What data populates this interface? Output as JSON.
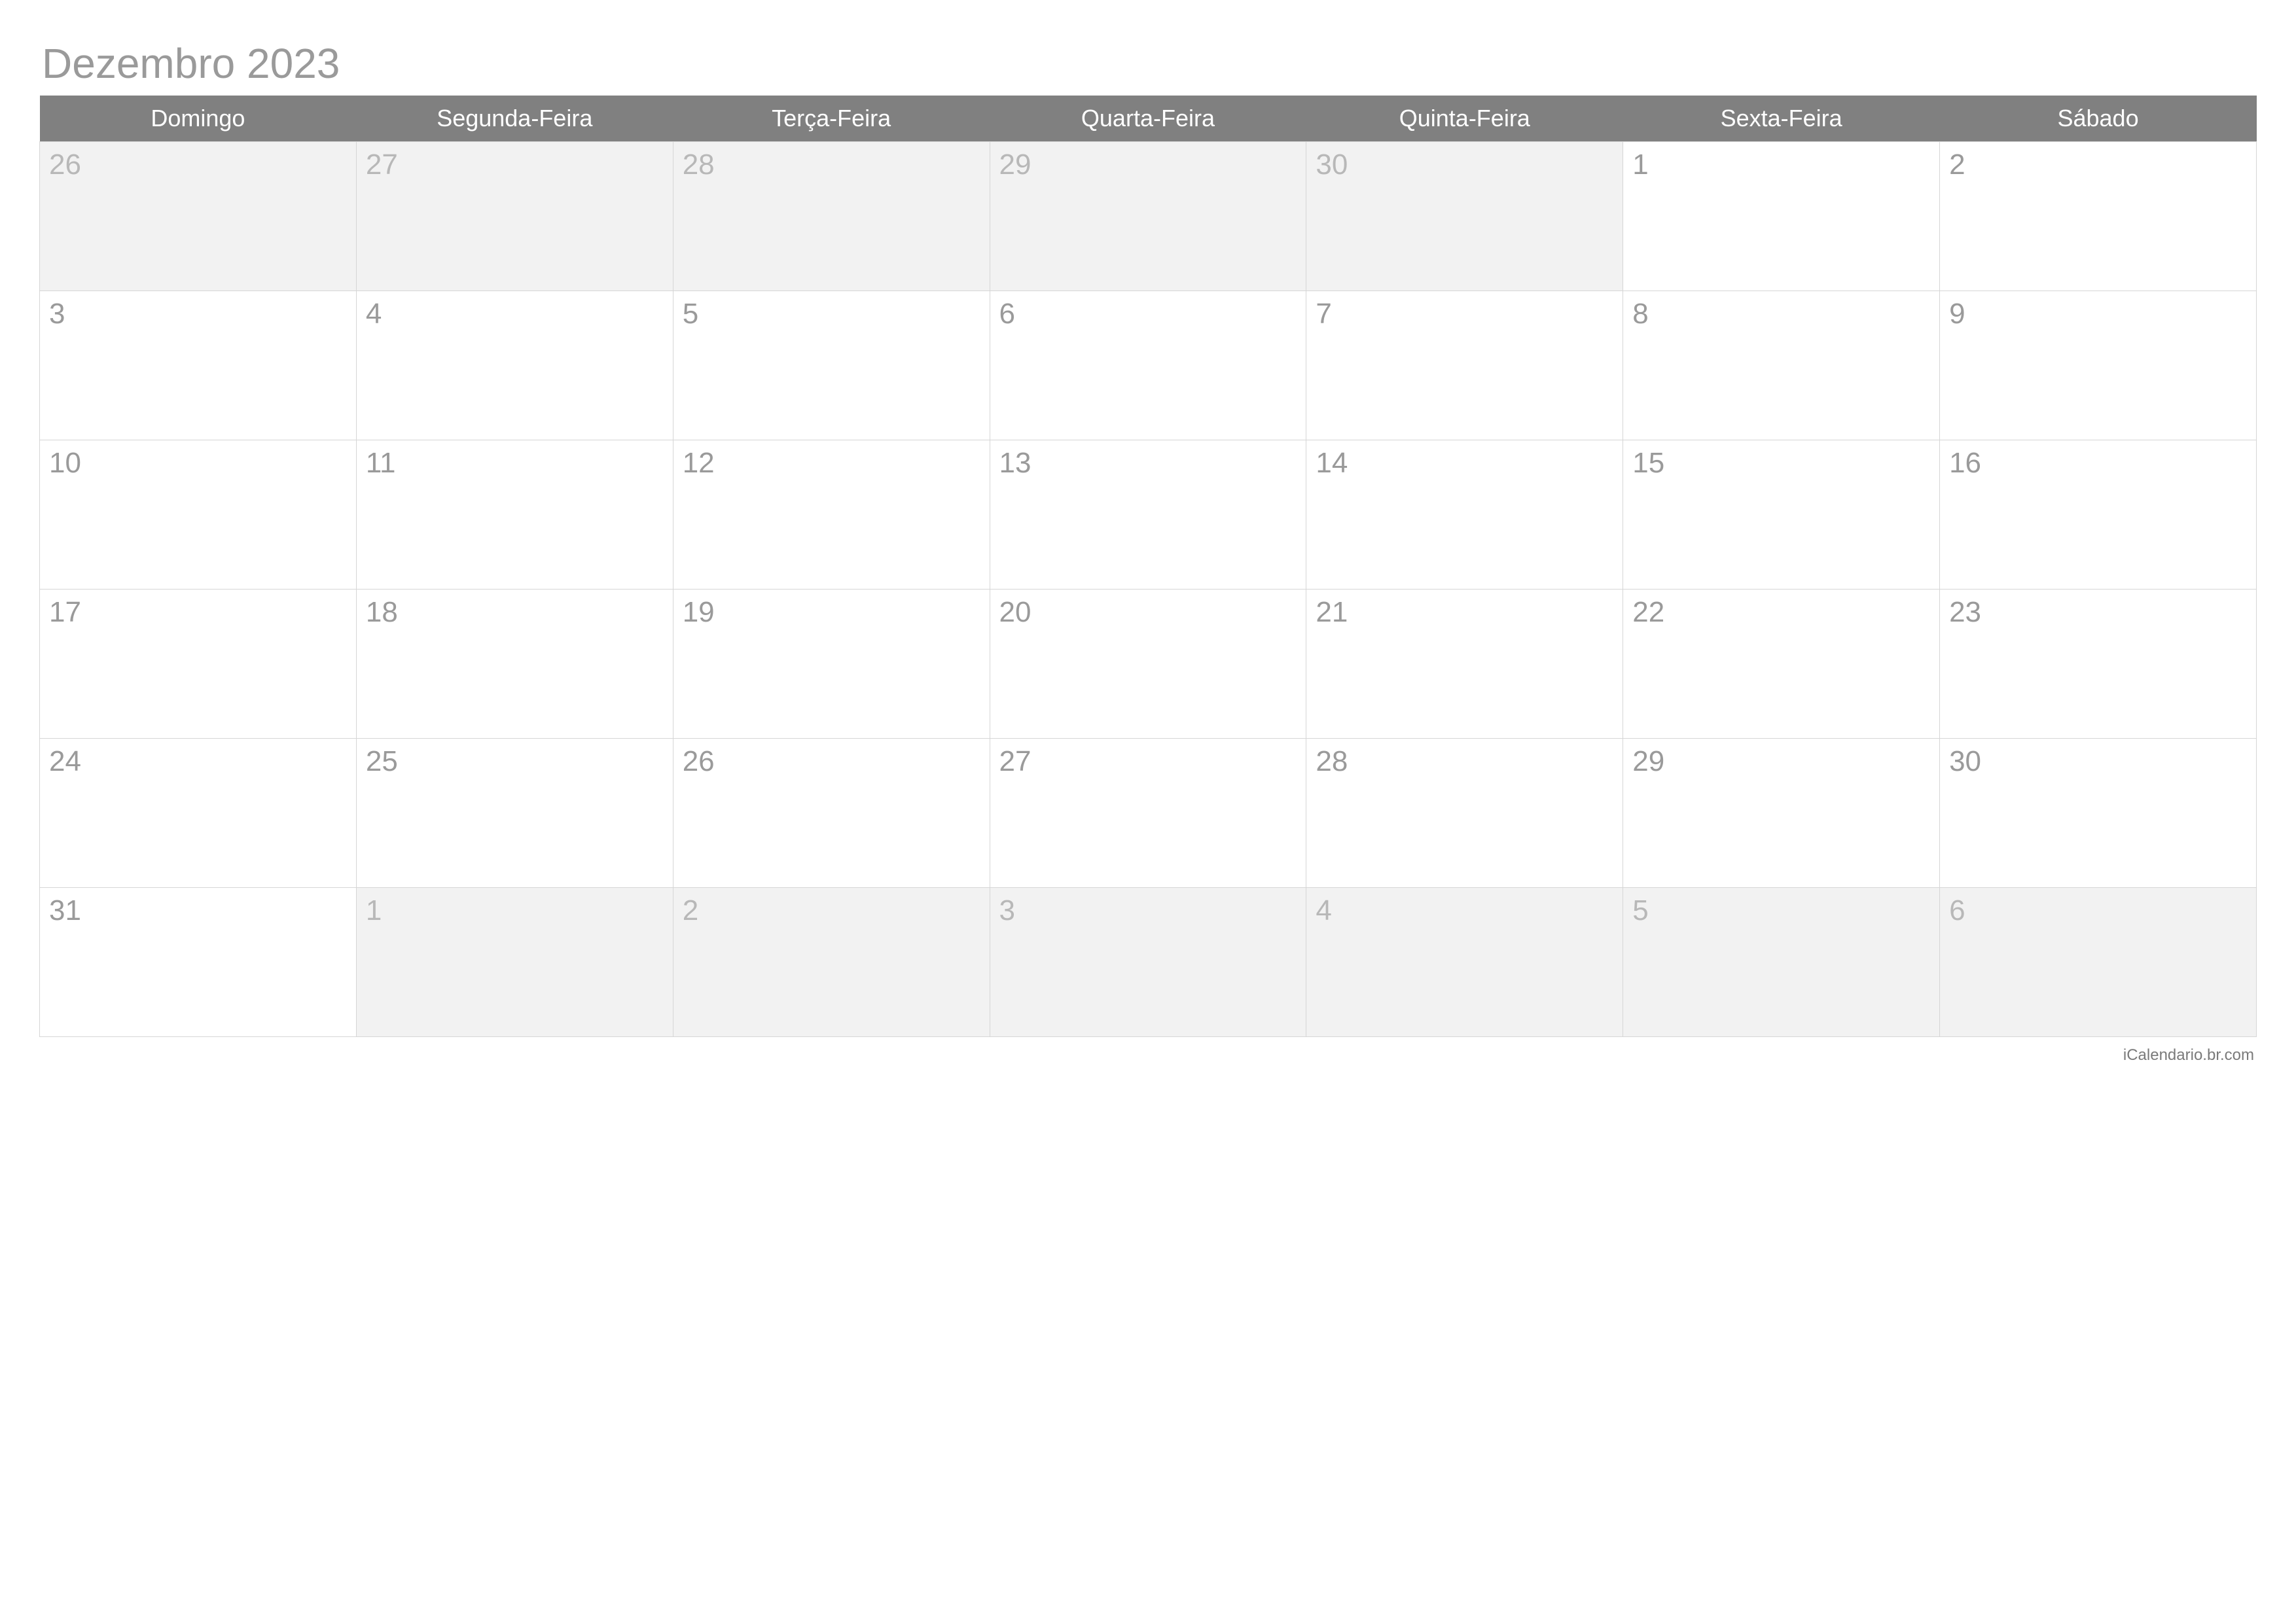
{
  "title": "Dezembro 2023",
  "weekdays": [
    "Domingo",
    "Segunda-Feira",
    "Terça-Feira",
    "Quarta-Feira",
    "Quinta-Feira",
    "Sexta-Feira",
    "Sábado"
  ],
  "weeks": [
    [
      {
        "day": "26",
        "other_month": true
      },
      {
        "day": "27",
        "other_month": true
      },
      {
        "day": "28",
        "other_month": true
      },
      {
        "day": "29",
        "other_month": true
      },
      {
        "day": "30",
        "other_month": true
      },
      {
        "day": "1",
        "other_month": false
      },
      {
        "day": "2",
        "other_month": false
      }
    ],
    [
      {
        "day": "3",
        "other_month": false
      },
      {
        "day": "4",
        "other_month": false
      },
      {
        "day": "5",
        "other_month": false
      },
      {
        "day": "6",
        "other_month": false
      },
      {
        "day": "7",
        "other_month": false
      },
      {
        "day": "8",
        "other_month": false
      },
      {
        "day": "9",
        "other_month": false
      }
    ],
    [
      {
        "day": "10",
        "other_month": false
      },
      {
        "day": "11",
        "other_month": false
      },
      {
        "day": "12",
        "other_month": false
      },
      {
        "day": "13",
        "other_month": false
      },
      {
        "day": "14",
        "other_month": false
      },
      {
        "day": "15",
        "other_month": false
      },
      {
        "day": "16",
        "other_month": false
      }
    ],
    [
      {
        "day": "17",
        "other_month": false
      },
      {
        "day": "18",
        "other_month": false
      },
      {
        "day": "19",
        "other_month": false
      },
      {
        "day": "20",
        "other_month": false
      },
      {
        "day": "21",
        "other_month": false
      },
      {
        "day": "22",
        "other_month": false
      },
      {
        "day": "23",
        "other_month": false
      }
    ],
    [
      {
        "day": "24",
        "other_month": false
      },
      {
        "day": "25",
        "other_month": false
      },
      {
        "day": "26",
        "other_month": false
      },
      {
        "day": "27",
        "other_month": false
      },
      {
        "day": "28",
        "other_month": false
      },
      {
        "day": "29",
        "other_month": false
      },
      {
        "day": "30",
        "other_month": false
      }
    ],
    [
      {
        "day": "31",
        "other_month": false
      },
      {
        "day": "1",
        "other_month": true
      },
      {
        "day": "2",
        "other_month": true
      },
      {
        "day": "3",
        "other_month": true
      },
      {
        "day": "4",
        "other_month": true
      },
      {
        "day": "5",
        "other_month": true
      },
      {
        "day": "6",
        "other_month": true
      }
    ]
  ],
  "footer": "iCalendario.br.com"
}
